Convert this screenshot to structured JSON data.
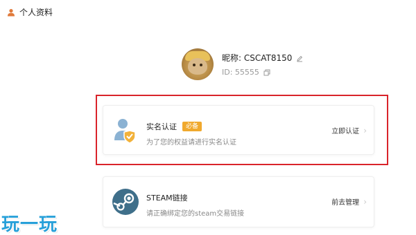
{
  "header": {
    "title": "个人资料",
    "icon": "person-icon"
  },
  "profile": {
    "nickname_label": "昵称: CSCAT8150",
    "id_label": "ID: 55555",
    "edit_icon": "edit-icon",
    "copy_icon": "copy-icon"
  },
  "verification_card": {
    "title": "实名认证",
    "badge": "必备",
    "description": "为了您的权益请进行实名认证",
    "action_label": "立即认证",
    "icon": "identity-shield-icon"
  },
  "steam_card": {
    "title": "STEAM链接",
    "description": "请正确绑定您的steam交易链接",
    "action_label": "前去管理",
    "icon": "steam-logo-icon"
  },
  "watermark": {
    "text": "玩一玩"
  },
  "colors": {
    "highlight": "#d9232a",
    "badge": "#f0a92e",
    "identity_blue": "#8bb2d3",
    "shield_orange": "#f2b23a",
    "steam": "#3f6f8a",
    "watermark": "#27a0d9"
  }
}
